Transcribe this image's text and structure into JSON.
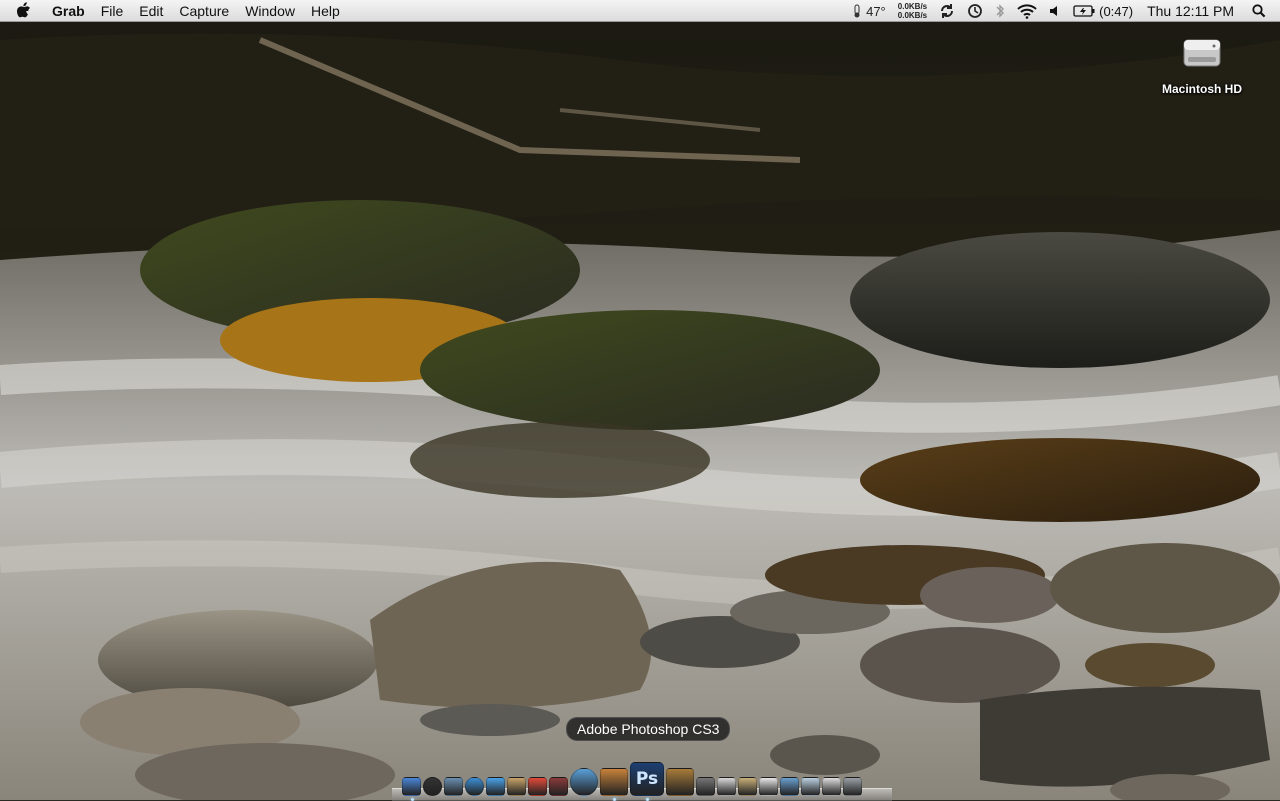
{
  "menubar": {
    "apple_icon": "apple-icon",
    "app_name": "Grab",
    "menus": [
      "File",
      "Edit",
      "Capture",
      "Window",
      "Help"
    ],
    "status": {
      "temperature": "47°",
      "net_up": "0.0KB/s",
      "net_down": "0.0KB/s",
      "battery_time": "(0:47)",
      "clock": "Thu 12:11 PM"
    },
    "status_icons": [
      "weather-icon",
      "sync-icon",
      "time-machine-icon",
      "bluetooth-icon",
      "wifi-icon",
      "volume-icon",
      "battery-icon",
      "spotlight-icon"
    ]
  },
  "desktop": {
    "icons": [
      {
        "label": "Macintosh HD",
        "icon": "hard-drive-icon"
      }
    ]
  },
  "dock": {
    "tooltip": "Adobe Photoshop CS3",
    "items": [
      {
        "name": "finder",
        "color": "#4a86d8"
      },
      {
        "name": "dashboard",
        "color": "#333333"
      },
      {
        "name": "preview",
        "color": "#6a8fb0"
      },
      {
        "name": "safari",
        "color": "#3d8fd6"
      },
      {
        "name": "ichat",
        "color": "#4aa2e8"
      },
      {
        "name": "address-book",
        "color": "#c9a46a"
      },
      {
        "name": "ical",
        "color": "#e24a3a"
      },
      {
        "name": "photo-booth",
        "color": "#8a3a3a"
      },
      {
        "name": "itunes",
        "color": "#5aa0d8"
      },
      {
        "name": "iphoto",
        "color": "#c7823a"
      },
      {
        "name": "photoshop",
        "color": "#1d3f72",
        "label": "Ps"
      },
      {
        "name": "image-capture",
        "color": "#a87b3a"
      },
      {
        "name": "system-preferences",
        "color": "#777777"
      },
      {
        "name": "script-editor",
        "color": "#d8d8d8"
      },
      {
        "name": "documents-stack",
        "color": "#c9b07a"
      },
      {
        "name": "downloads-stack",
        "color": "#e8e8e8"
      },
      {
        "name": "applications-folder",
        "color": "#6aa0d0"
      },
      {
        "name": "mail-document",
        "color": "#bcd0e0"
      },
      {
        "name": "drive-stack",
        "color": "#dddddd"
      },
      {
        "name": "trash",
        "color": "#9aa0a6"
      }
    ]
  }
}
